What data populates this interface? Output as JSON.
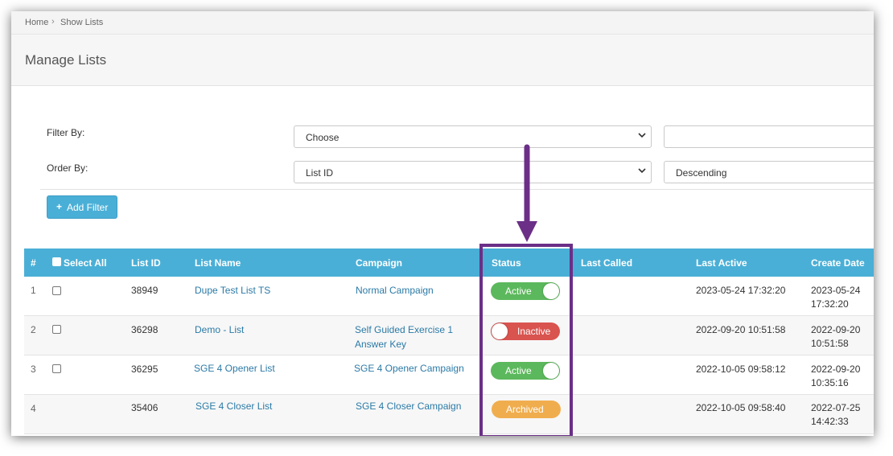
{
  "breadcrumb": {
    "home": "Home",
    "separator": "›",
    "current": "Show Lists"
  },
  "page": {
    "title": "Manage Lists"
  },
  "filters": {
    "filter_by_label": "Filter By:",
    "filter_by_value": "Choose",
    "filter_value_input": "",
    "order_by_label": "Order By:",
    "order_by_value": "List ID",
    "order_direction_value": "Descending",
    "add_filter_plus": "+",
    "add_filter_label": "Add Filter"
  },
  "table": {
    "headers": {
      "num": "#",
      "select_all": "Select All",
      "list_id": "List ID",
      "list_name": "List Name",
      "campaign": "Campaign",
      "status": "Status",
      "last_called": "Last Called",
      "last_active": "Last Active",
      "create_date": "Create Date"
    },
    "rows": [
      {
        "num": "1",
        "list_id": "38949",
        "list_name": "Dupe Test List TS",
        "campaign": "Normal Campaign",
        "campaign_line2": "",
        "status": "Active",
        "last_called": "",
        "last_active": "2023-05-24 17:32:20",
        "create_date": "2023-05-24",
        "create_time": "17:32:20"
      },
      {
        "num": "2",
        "list_id": "36298",
        "list_name": "Demo - List",
        "campaign": "Self Guided Exercise 1",
        "campaign_line2": "Answer Key",
        "status": "Inactive",
        "last_called": "",
        "last_active": "2022-09-20 10:51:58",
        "create_date": "2022-09-20",
        "create_time": "10:51:58"
      },
      {
        "num": "3",
        "list_id": "36295",
        "list_name": "SGE 4 Opener List",
        "campaign": "SGE 4 Opener Campaign",
        "campaign_line2": "",
        "status": "Active",
        "last_called": "",
        "last_active": "2022-10-05 09:58:12",
        "create_date": "2022-09-20",
        "create_time": "10:35:16"
      },
      {
        "num": "4",
        "list_id": "35406",
        "list_name": "SGE 4 Closer List",
        "campaign": "SGE 4 Closer Campaign",
        "campaign_line2": "",
        "status": "Archived",
        "last_called": "",
        "last_active": "2022-10-05 09:58:40",
        "create_date": "2022-07-25",
        "create_time": "14:42:33"
      }
    ]
  },
  "colors": {
    "header": "#4aafd6",
    "link": "#2b7aa6",
    "active": "#5cb85c",
    "inactive": "#d9534f",
    "archived": "#f0ad4e",
    "highlight": "#6b2f87"
  },
  "icons": {
    "chevron": "chevron-down-icon",
    "arrow": "arrow-down-icon"
  }
}
